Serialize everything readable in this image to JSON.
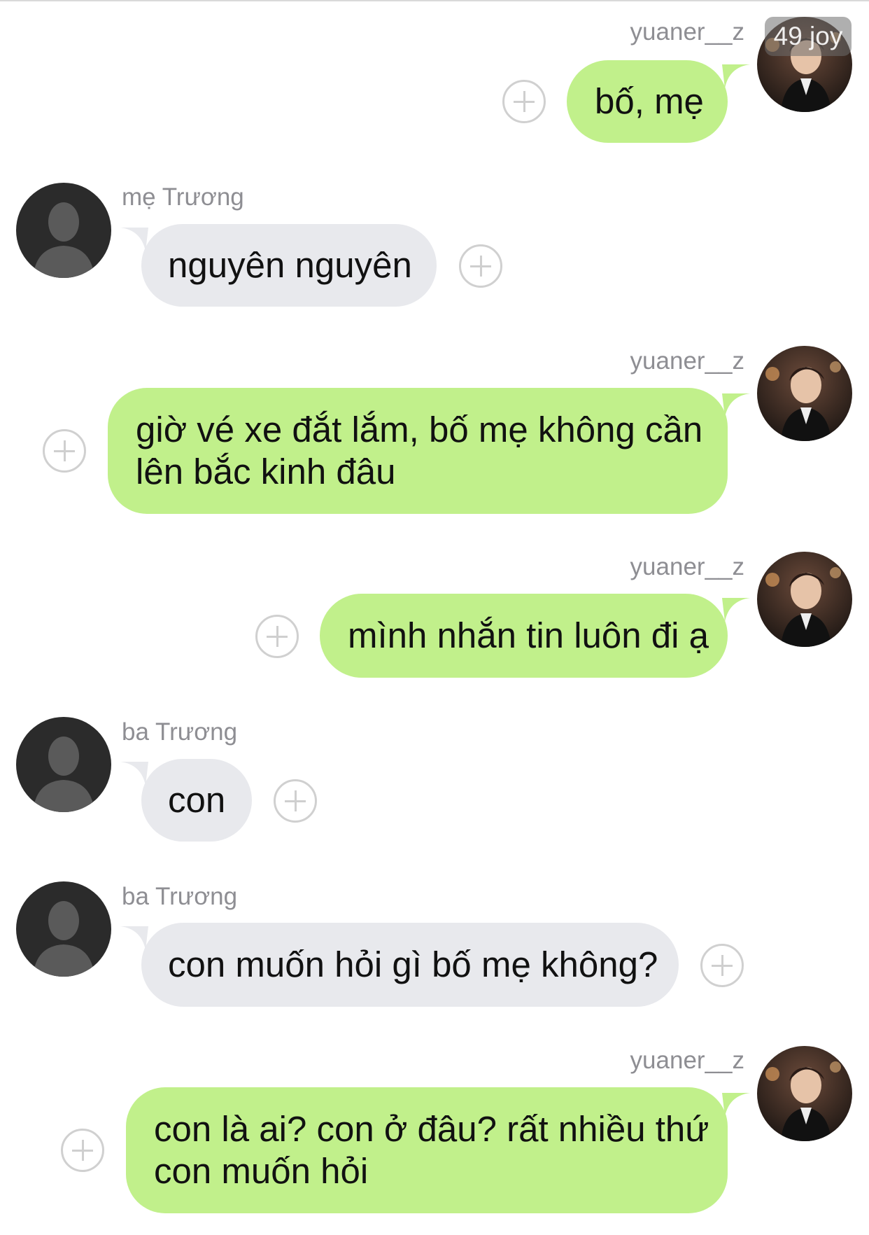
{
  "watermark": "49 joy",
  "colors": {
    "outgoing_bubble": "#c1f08b",
    "incoming_bubble": "#e8e9ed",
    "sender_name": "#8e8e93",
    "background": "#ffffff"
  },
  "messages": [
    {
      "sender": "yuaner__z",
      "direction": "outgoing",
      "text": "bố, mẹ",
      "avatar_icon": "user-photo-avatar-icon"
    },
    {
      "sender": "mẹ Trương",
      "direction": "incoming",
      "text": "nguyên nguyên",
      "avatar_icon": "default-person-avatar-icon"
    },
    {
      "sender": "yuaner__z",
      "direction": "outgoing",
      "text": "giờ vé xe đắt lắm, bố mẹ không cần\nlên bắc kinh đâu",
      "avatar_icon": "user-photo-avatar-icon"
    },
    {
      "sender": "yuaner__z",
      "direction": "outgoing",
      "text": "mình nhắn tin luôn đi ạ",
      "avatar_icon": "user-photo-avatar-icon"
    },
    {
      "sender": "ba Trương",
      "direction": "incoming",
      "text": "con",
      "avatar_icon": "default-person-avatar-icon"
    },
    {
      "sender": "ba Trương",
      "direction": "incoming",
      "text": "con muốn hỏi gì bố mẹ không?",
      "avatar_icon": "default-person-avatar-icon"
    },
    {
      "sender": "yuaner__z",
      "direction": "outgoing",
      "text": "con là ai? con ở đâu? rất nhiều thứ\ncon muốn hỏi",
      "avatar_icon": "user-photo-avatar-icon"
    }
  ]
}
